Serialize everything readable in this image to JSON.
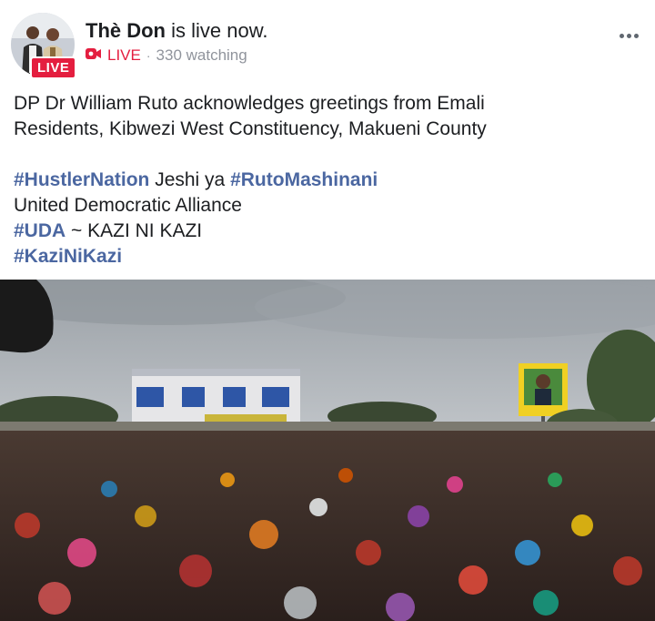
{
  "post": {
    "page_name": "Thè Don",
    "status": " is live now.",
    "avatar_live_badge": "LIVE",
    "live_label": "LIVE",
    "separator": "·",
    "watching": "330 watching",
    "more_icon": "more-horizontal-icon"
  },
  "caption": {
    "line1": "DP Dr William Ruto acknowledges greetings from Emali",
    "line2": "Residents, Kibwezi West Constituency, Makueni County",
    "tag_hustler": "#HustlerNation",
    "text_jeshi": " Jeshi ya ",
    "tag_ruto": "#RutoMashinani",
    "line_uda_full": "United Democratic Alliance",
    "tag_uda": "#UDA",
    "text_kazi": " ~ KAZI NI KAZI",
    "tag_kazinikazi": "#KaziNiKazi"
  },
  "colors": {
    "live_red": "#e41e3f",
    "hashtag_blue": "#4b67a1",
    "meta_gray": "#90949c"
  }
}
